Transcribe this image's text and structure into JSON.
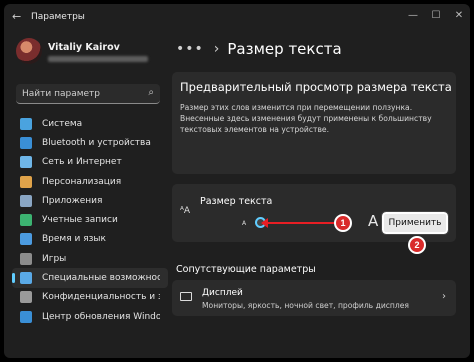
{
  "window": {
    "title": "Параметры"
  },
  "user": {
    "name": "Vitaliy Kairov"
  },
  "search": {
    "placeholder": "Найти параметр"
  },
  "sidebar": {
    "items": [
      {
        "label": "Система",
        "icon": "system-icon",
        "color": "#4aa3df"
      },
      {
        "label": "Bluetooth и устройства",
        "icon": "bluetooth-icon",
        "color": "#3a8fd6"
      },
      {
        "label": "Сеть и Интернет",
        "icon": "network-icon",
        "color": "#6fb6e8"
      },
      {
        "label": "Персонализация",
        "icon": "brush-icon",
        "color": "#e0a34a"
      },
      {
        "label": "Приложения",
        "icon": "apps-icon",
        "color": "#8aa6c4"
      },
      {
        "label": "Учетные записи",
        "icon": "account-icon",
        "color": "#3cb371"
      },
      {
        "label": "Время и язык",
        "icon": "globe-clock-icon",
        "color": "#4c9be0"
      },
      {
        "label": "Игры",
        "icon": "gamepad-icon",
        "color": "#8c8c8c"
      },
      {
        "label": "Специальные возможности",
        "icon": "accessibility-icon",
        "color": "#5aa9e6"
      },
      {
        "label": "Конфиденциальность и защита",
        "icon": "shield-icon",
        "color": "#9a9a9a"
      },
      {
        "label": "Центр обновления Windows",
        "icon": "update-icon",
        "color": "#3a8fd6"
      }
    ],
    "active_index": 8
  },
  "breadcrumb": {
    "dots": "•••",
    "separator": "›",
    "title": "Размер текста"
  },
  "preview": {
    "title": "Предварительный просмотр размера текста",
    "text": "Размер этих слов изменится при перемещении ползунка. Внесенные здесь изменения будут применены к большинству текстовых элементов на устройстве."
  },
  "text_size": {
    "icon_glyph": "ᴬA",
    "label": "Размер текста",
    "small_a": "A",
    "big_a": "A",
    "apply_label": "Применить",
    "slider_value": 0
  },
  "annotations": {
    "badge1": "1",
    "badge2": "2",
    "arrow_color": "#e81e24"
  },
  "related": {
    "title": "Сопутствующие параметры",
    "display": {
      "title": "Дисплей",
      "subtitle": "Мониторы, яркость, ночной свет, профиль дисплея",
      "chevron": "›"
    }
  },
  "accent_color": "#60cdff"
}
